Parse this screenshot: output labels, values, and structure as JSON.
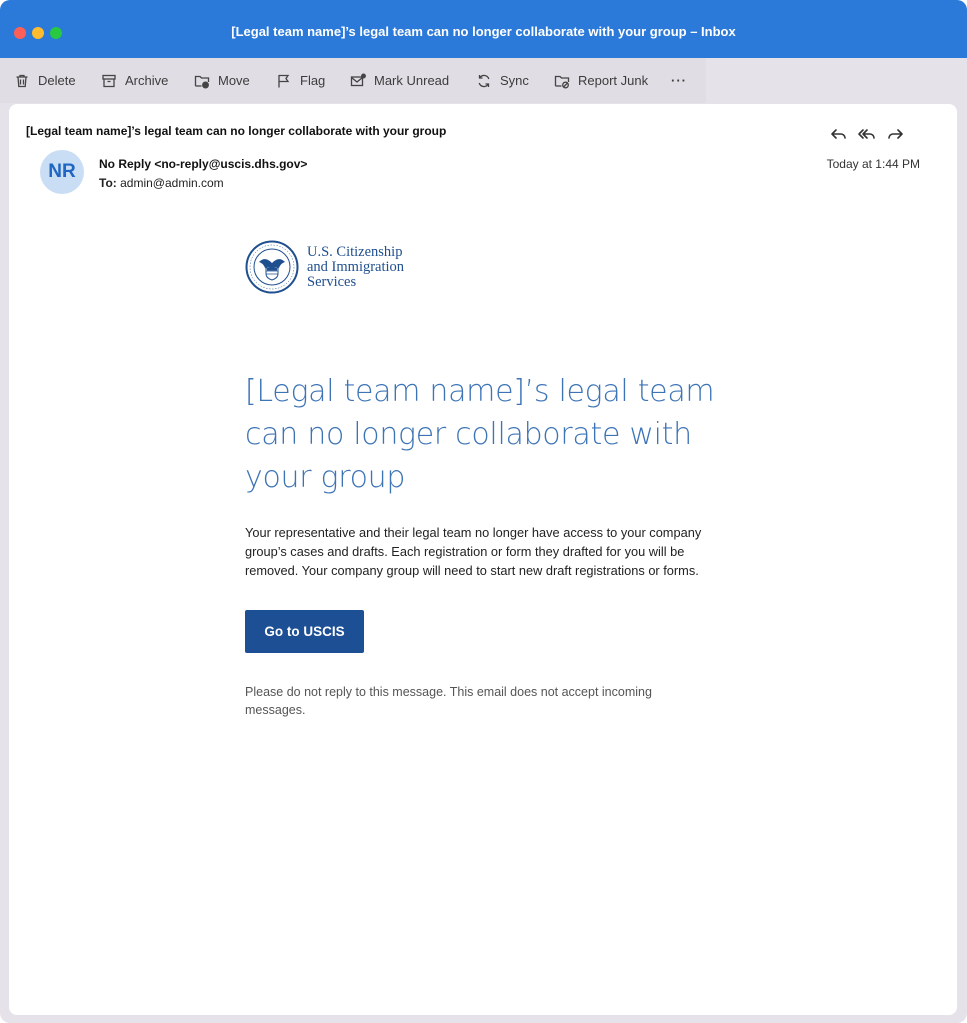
{
  "window": {
    "title": "[Legal team name]’s legal team can no longer collaborate with your group – Inbox"
  },
  "toolbar": {
    "delete_label": "Delete",
    "archive_label": "Archive",
    "move_label": "Move",
    "flag_label": "Flag",
    "mark_unread_label": "Mark Unread",
    "sync_label": "Sync",
    "report_junk_label": "Report Junk",
    "more_label": "···"
  },
  "message": {
    "subject": "[Legal team name]’s legal team can no longer collaborate with your group",
    "avatar_initials": "NR",
    "from": "No Reply <no-reply@uscis.dhs.gov>",
    "to_label": "To:",
    "to_address": "admin@admin.com",
    "date": "Today at 1:44 PM"
  },
  "email": {
    "agency_line1": "U.S. Citizenship",
    "agency_line2": "and Immigration",
    "agency_line3": "Services",
    "headline": "[Legal team name]’s legal team can no longer collaborate with your group",
    "body": "Your representative and their legal team no longer have access to your company group’s cases and drafts. Each registration or form they drafted for you will be removed. Your company group will need to start new draft registrations or forms.",
    "button_label": "Go to USCIS",
    "footer": "Please do not reply to this message. This email does not accept incoming messages."
  },
  "colors": {
    "titlebar": "#2b79d8",
    "headline": "#3d74b6",
    "button": "#1d4f94"
  }
}
